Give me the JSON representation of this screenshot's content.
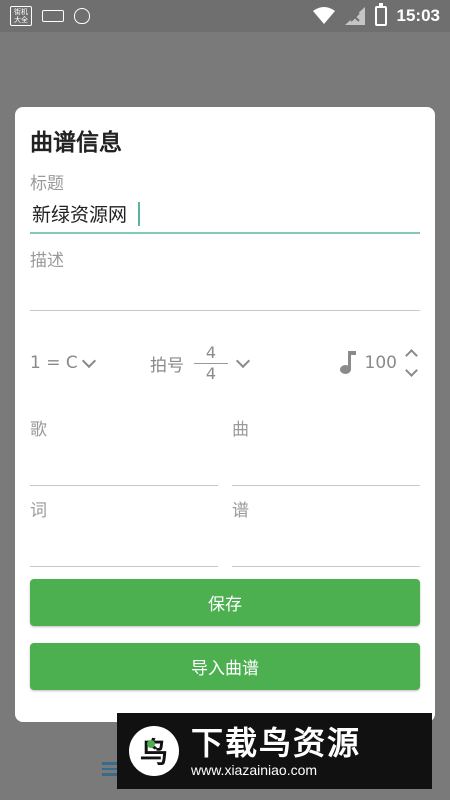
{
  "status_bar": {
    "app_icon_text": "街机大全",
    "time": "15:03"
  },
  "dialog": {
    "title": "曲谱信息",
    "title_field": {
      "label": "标题",
      "value": "新绿资源网"
    },
    "desc_field": {
      "label": "描述",
      "value": ""
    },
    "key": "1 = C",
    "beat": {
      "label": "拍号",
      "numerator": "4",
      "denominator": "4"
    },
    "tempo": "100",
    "song": {
      "label": "歌"
    },
    "music": {
      "label": "曲"
    },
    "lyrics": {
      "label": "词"
    },
    "notation": {
      "label": "谱"
    },
    "save_label": "保存",
    "import_label": "导入曲谱"
  },
  "watermark": {
    "logo_char": "鸟",
    "title": "下载鸟资源",
    "url": "www.xiazainiao.com"
  },
  "colors": {
    "accent": "#4caf50",
    "focus_underline": "#7fcab8",
    "overlay": "#7a7a7a"
  }
}
